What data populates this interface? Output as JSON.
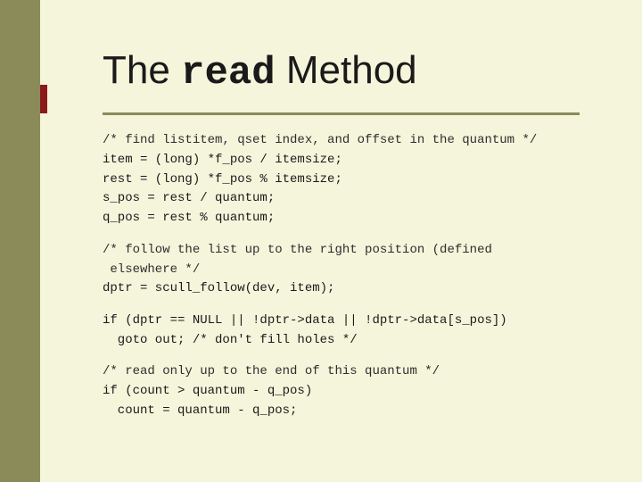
{
  "slide": {
    "title": {
      "prefix": "The ",
      "mono": "read",
      "suffix": " Method"
    },
    "code_sections": [
      {
        "id": "section1",
        "lines": [
          "/* find listitem, qset index, and offset in the quantum */",
          "item = (long) *f_pos / itemsize;",
          "rest = (long) *f_pos % itemsize;",
          "s_pos = rest / quantum;",
          "q_pos = rest % quantum;"
        ]
      },
      {
        "id": "section2",
        "lines": [
          "/* follow the list up to the right position (defined",
          " elsewhere */",
          "dptr = scull_follow(dev, item);"
        ]
      },
      {
        "id": "section3",
        "lines": [
          "if (dptr == NULL || !dptr->data || !dptr->data[s_pos])",
          "  goto out; /* don't fill holes */"
        ]
      },
      {
        "id": "section4",
        "lines": [
          "/* read only up to the end of this quantum */",
          "if (count > quantum - q_pos)",
          "  count = quantum - q_pos;"
        ]
      }
    ]
  }
}
